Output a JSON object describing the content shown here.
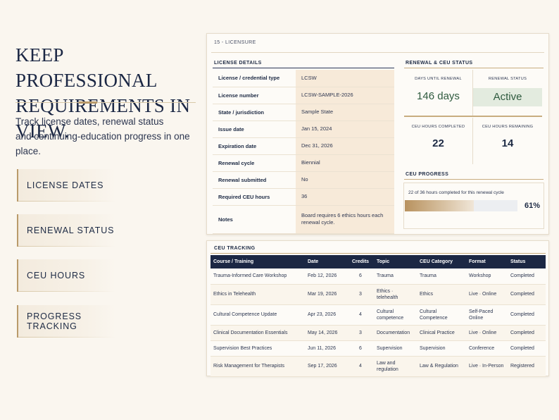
{
  "hero": {
    "title": "Keep professional requirements in view.",
    "subtitle_line1": "Track license dates, renewal status",
    "subtitle_line2": "and continuing-education progress in one place."
  },
  "features": [
    "License dates",
    "Renewal status",
    "CEU hours",
    "Progress tracking"
  ],
  "sheet": {
    "label": "15 - Licensure"
  },
  "license_details": {
    "title": "License details",
    "rows": [
      {
        "key": "License / credential type",
        "value": "LCSW"
      },
      {
        "key": "License number",
        "value": "LCSW-SAMPLE-2026"
      },
      {
        "key": "State / jurisdiction",
        "value": "Sample State"
      },
      {
        "key": "Issue date",
        "value": "Jan 15, 2024"
      },
      {
        "key": "Expiration date",
        "value": "Dec 31, 2026"
      },
      {
        "key": "Renewal cycle",
        "value": "Biennial"
      },
      {
        "key": "Renewal submitted",
        "value": "No"
      },
      {
        "key": "Required CEU hours",
        "value": "36"
      },
      {
        "key": "Notes",
        "value": "Board requires 6 ethics hours each renewal cycle."
      }
    ]
  },
  "status": {
    "title": "Renewal & CEU status",
    "days_label": "Days until renewal",
    "days_value": "146 days",
    "renewal_label": "Renewal status",
    "renewal_value": "Active",
    "completed_label": "CEU hours completed",
    "completed_value": "22",
    "remaining_label": "CEU hours remaining",
    "remaining_value": "14",
    "accent_color": "#2e5a3e"
  },
  "progress": {
    "title": "CEU progress",
    "caption": "22 of 36 hours completed for this renewal cycle",
    "percent_label": "61%",
    "fraction": 0.61
  },
  "ceu_tracking": {
    "title": "CEU tracking",
    "columns": [
      "Course / Training",
      "Date",
      "Credits",
      "Topic",
      "CEU Category",
      "Format",
      "Status"
    ],
    "rows": [
      [
        "Trauma-Informed Care Workshop",
        "Feb 12, 2026",
        "6",
        "Trauma",
        "Trauma",
        "Workshop",
        "Completed"
      ],
      [
        "Ethics in Telehealth",
        "Mar 19, 2026",
        "3",
        "Ethics · telehealth",
        "Ethics",
        "Live · Online",
        "Completed"
      ],
      [
        "Cultural Competence Update",
        "Apr 23, 2026",
        "4",
        "Cultural competence",
        "Cultural Competence",
        "Self-Paced Online",
        "Completed"
      ],
      [
        "Clinical Documentation Essentials",
        "May 14, 2026",
        "3",
        "Documentation",
        "Clinical Practice",
        "Live · Online",
        "Completed"
      ],
      [
        "Supervision Best Practices",
        "Jun 11, 2026",
        "6",
        "Supervision",
        "Supervision",
        "Conference",
        "Completed"
      ],
      [
        "Risk Management for Therapists",
        "Sep 17, 2026",
        "4",
        "Law and regulation",
        "Law & Regulation",
        "Live · In-Person",
        "Registered"
      ]
    ]
  },
  "colors": {
    "navy": "#1b2744",
    "gold": "#b99a6a",
    "cream": "#faf6ef"
  }
}
